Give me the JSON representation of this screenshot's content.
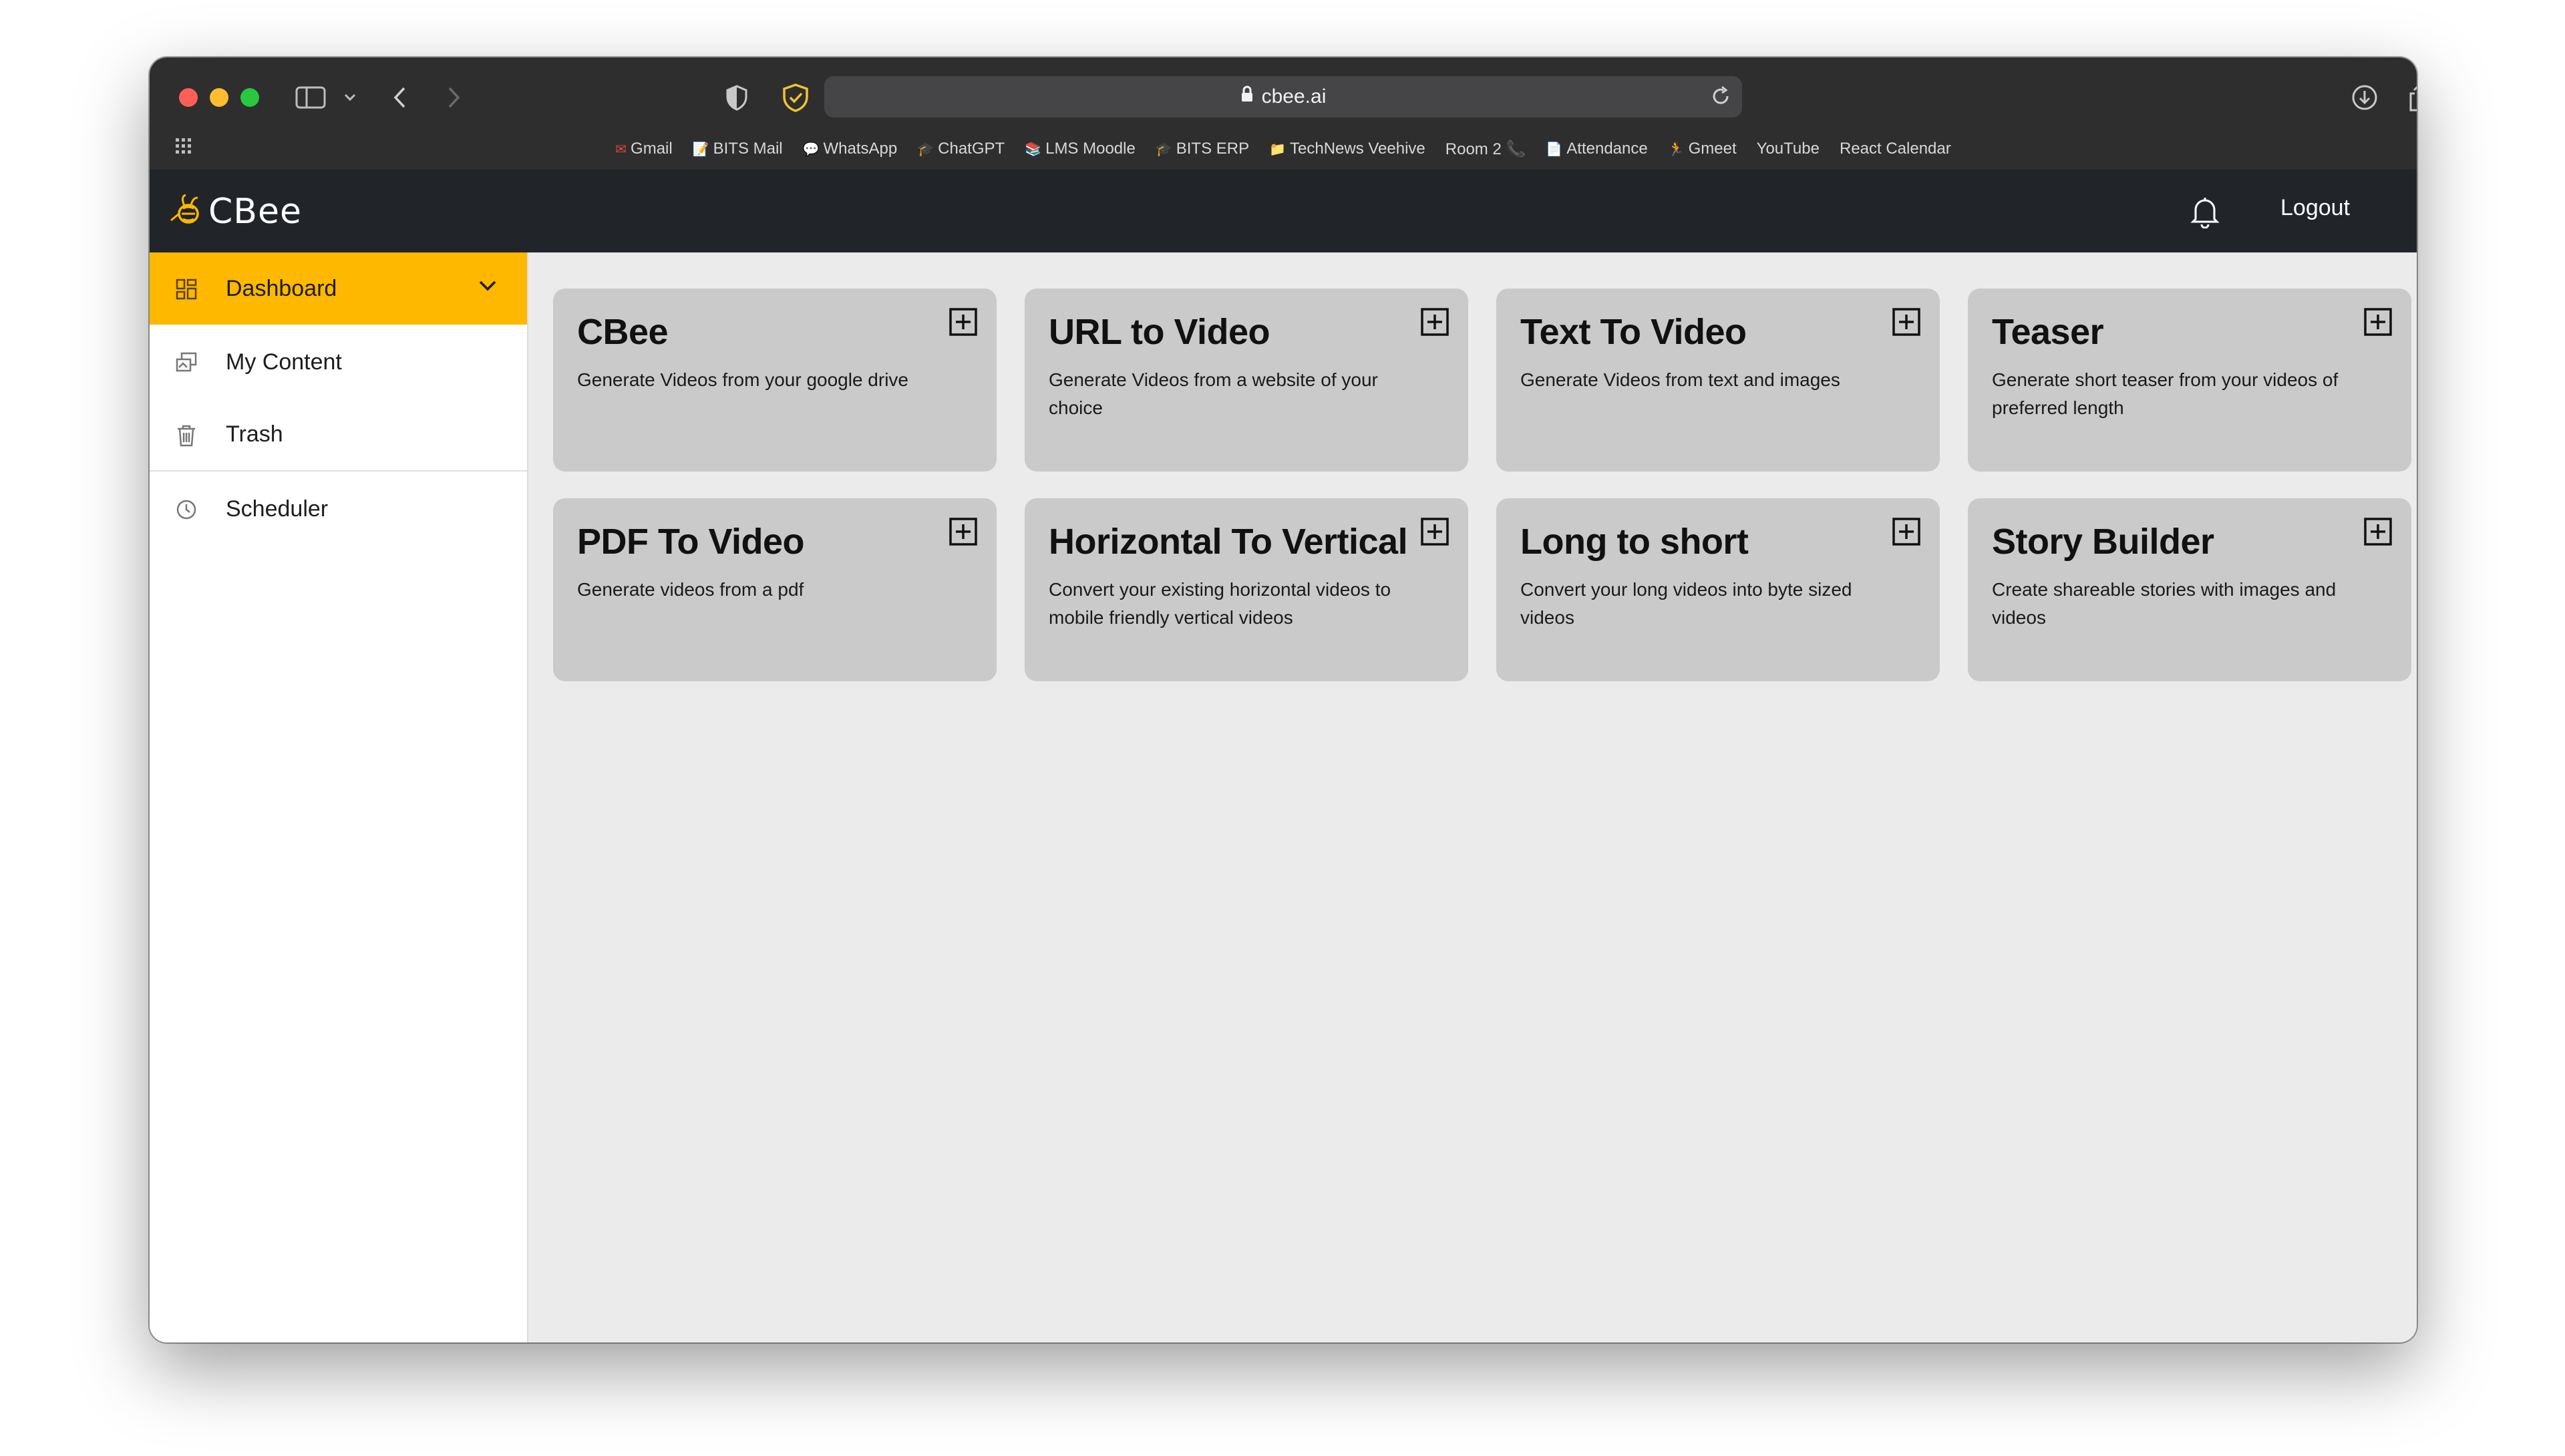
{
  "browser": {
    "url": "cbee.ai",
    "bookmarks": [
      {
        "label": "Gmail",
        "icon": "gmail-icon",
        "glyph": "✉"
      },
      {
        "label": "BITS Mail",
        "icon": "note-icon",
        "glyph": "📝"
      },
      {
        "label": "WhatsApp",
        "icon": "chat-icon",
        "glyph": "💬"
      },
      {
        "label": "ChatGPT",
        "icon": "grad-cap-icon",
        "glyph": "🎓"
      },
      {
        "label": "LMS Moodle",
        "icon": "books-icon",
        "glyph": "📚"
      },
      {
        "label": "BITS ERP",
        "icon": "grad-cap-icon",
        "glyph": "🎓"
      },
      {
        "label": "TechNews Veehive",
        "icon": "folder-icon",
        "glyph": "📁"
      },
      {
        "label": "Room 2 📞",
        "icon": "",
        "glyph": ""
      },
      {
        "label": "Attendance",
        "icon": "document-icon",
        "glyph": "📄"
      },
      {
        "label": "Gmeet",
        "icon": "runner-icon",
        "glyph": "🏃"
      },
      {
        "label": "YouTube",
        "icon": "",
        "glyph": ""
      },
      {
        "label": "React Calendar",
        "icon": "",
        "glyph": ""
      }
    ]
  },
  "header": {
    "logo": "CBee",
    "logout": "Logout",
    "accent": "#ffb800",
    "bg": "#212429"
  },
  "sidebar": {
    "items": [
      {
        "label": "Dashboard",
        "icon": "dashboard-grid-icon",
        "active": true
      },
      {
        "label": "My Content",
        "icon": "content-icon",
        "active": false
      },
      {
        "label": "Trash",
        "icon": "trash-icon",
        "active": false
      },
      {
        "label": "Scheduler",
        "icon": "clock-icon",
        "active": false
      }
    ]
  },
  "cards": [
    {
      "title": "CBee",
      "desc": "Generate Videos from your google drive"
    },
    {
      "title": "URL to Video",
      "desc": "Generate Videos from a website of your choice"
    },
    {
      "title": "Text To Video",
      "desc": "Generate Videos from text and images"
    },
    {
      "title": "Teaser",
      "desc": "Generate short teaser from your videos of preferred length"
    },
    {
      "title": "PDF To Video",
      "desc": "Generate videos from a pdf"
    },
    {
      "title": "Horizontal To Vertical",
      "desc": "Convert your existing horizontal videos to mobile friendly vertical videos"
    },
    {
      "title": "Long to short",
      "desc": "Convert your long videos into byte sized videos"
    },
    {
      "title": "Story Builder",
      "desc": "Create shareable stories with images and videos"
    }
  ]
}
